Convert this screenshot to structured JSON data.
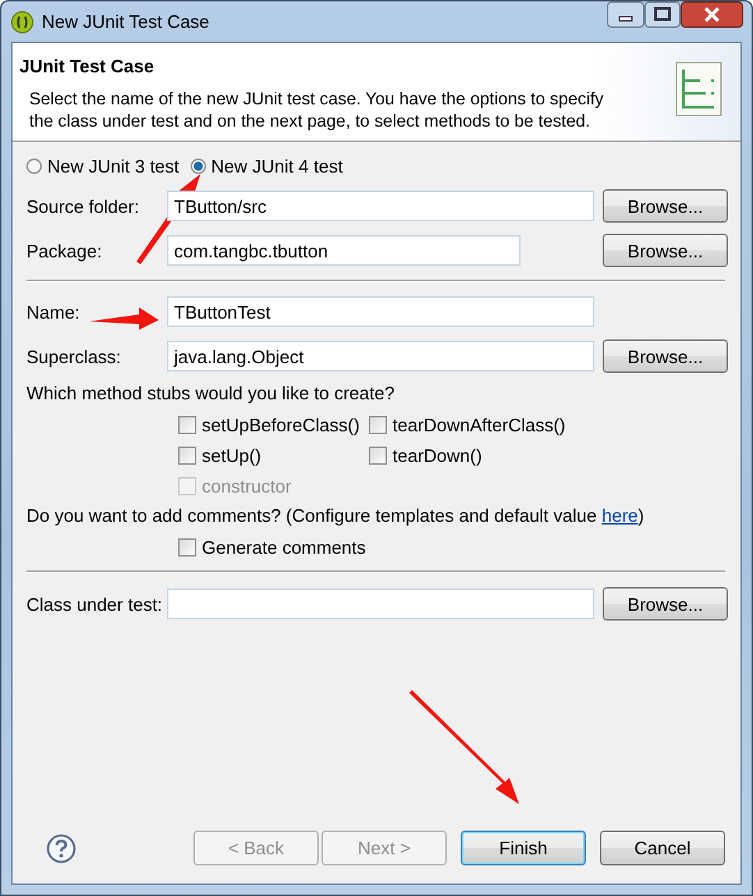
{
  "window": {
    "title": "New JUnit Test Case"
  },
  "header": {
    "title": "JUnit Test Case",
    "description": "Select the name of the new JUnit test case. You have the options to specify the class under test and on the next page, to select methods to be tested."
  },
  "junit_versions": [
    {
      "label": "New JUnit 3 test",
      "selected": false
    },
    {
      "label": "New JUnit 4 test",
      "selected": true
    }
  ],
  "location_fields": [
    {
      "label": "Source folder:",
      "value": "TButton/src",
      "kind": "long",
      "button": "Browse..."
    },
    {
      "label": "Package:",
      "value": "com.tangbc.tbutton",
      "kind": "short",
      "button": "Browse..."
    }
  ],
  "class_fields": [
    {
      "label": "Name:",
      "value": "TButtonTest",
      "kind": "long"
    },
    {
      "label": "Superclass:",
      "value": "java.lang.Object",
      "kind": "long",
      "button": "Browse..."
    }
  ],
  "stubs_question": "Which method stubs would you like to create?",
  "stubs": [
    {
      "label": "setUpBeforeClass()",
      "checked": false,
      "disabled": false
    },
    {
      "label": "tearDownAfterClass()",
      "checked": false,
      "disabled": false
    },
    {
      "label": "setUp()",
      "checked": false,
      "disabled": false
    },
    {
      "label": "tearDown()",
      "checked": false,
      "disabled": false
    },
    {
      "label": "constructor",
      "checked": false,
      "disabled": true
    }
  ],
  "comments": {
    "before": "Do you want to add comments? (Configure templates and default value ",
    "link": "here",
    "after": ")"
  },
  "generate_comments": {
    "label": "Generate comments",
    "checked": false
  },
  "class_under_test": {
    "label": "Class under test:",
    "button": "Browse..."
  },
  "footer_buttons": [
    {
      "label": "< Back",
      "disabled": true,
      "default": false
    },
    {
      "label": "Next >",
      "disabled": true,
      "default": false
    },
    {
      "label": "Finish",
      "disabled": false,
      "default": true
    },
    {
      "label": "Cancel",
      "disabled": false,
      "default": false
    }
  ]
}
